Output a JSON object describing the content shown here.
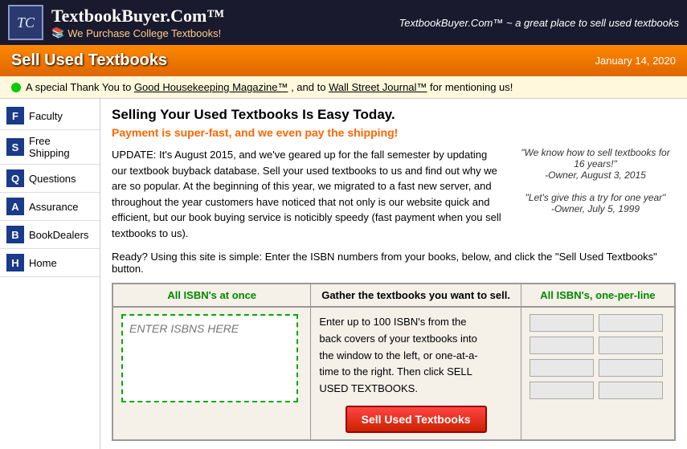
{
  "header": {
    "logo_text": "TC",
    "site_title": "TextbookBuyer.Com™",
    "site_subtitle": "We Purchase College Textbooks!",
    "tagline": "TextbookBuyer.Com™ ~ a great place to sell used textbooks"
  },
  "page_bar": {
    "title": "Sell Used Textbooks",
    "date": "January 14, 2020"
  },
  "thankyou_bar": {
    "text_before": "A special Thank You to",
    "link1": "Good Housekeeping Magazine™",
    "text_middle": ", and to",
    "link2": "Wall Street Journal™",
    "text_after": "for mentioning us!"
  },
  "nav": {
    "items": [
      {
        "letter": "F",
        "label": "Faculty",
        "color": "#1a3a8a"
      },
      {
        "letter": "S",
        "label": "Free Shipping",
        "color": "#1a3a8a"
      },
      {
        "letter": "Q",
        "label": "Questions",
        "color": "#1a3a8a"
      },
      {
        "letter": "A",
        "label": "Assurance",
        "color": "#1a3a8a"
      },
      {
        "letter": "B",
        "label": "BookDealers",
        "color": "#1a3a8a"
      },
      {
        "letter": "H",
        "label": "Home",
        "color": "#1a3a8a"
      }
    ]
  },
  "content": {
    "selling_title": "Selling Your Used Textbooks Is Easy Today.",
    "selling_subtitle": "Payment is super-fast, and we even pay the shipping!",
    "update_text": "UPDATE: It's August 2015, and we've geared up for the fall semester by updating our textbook buyback database. Sell your used textbooks to us and find out why we are so popular. At the beginning of this year, we migrated to a fast new server, and throughout the year customers have noticed that not only is our website quick and efficient, but our book buying service is noticibly speedy (fast payment when you sell textbooks to us).",
    "ready_text": "Ready? Using this site is simple: Enter the ISBN numbers from your books, below, and click the \"Sell Used Textbooks\" button.",
    "quotes": [
      {
        "text": "\"We know how to sell textbooks for 16 years!\"",
        "attribution": "-Owner, August 3, 2015"
      },
      {
        "text": "\"Let's give this a try for one year\"",
        "attribution": "-Owner, July 5, 1999"
      }
    ]
  },
  "isbn_section": {
    "col1_header": "All ISBN's at once",
    "col2_header": "Gather the textbooks you want to sell.",
    "col3_header": "All ISBN's, one-per-line",
    "textarea_placeholder": "ENTER ISBNS HERE",
    "middle_text": "Enter up to 100 ISBN's from the back covers of your textbooks into the window to the left, or one-at-a-time to the right. Then click SELL USED TEXTBOOKS.",
    "sell_button_label": "Sell Used Textbooks"
  }
}
